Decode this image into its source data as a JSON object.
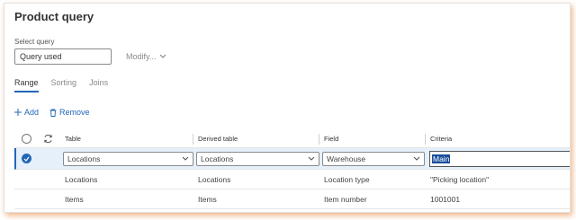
{
  "page": {
    "title": "Product query"
  },
  "query": {
    "label": "Select query",
    "value": "Query used"
  },
  "modify": {
    "label": "Modify..."
  },
  "tabs": [
    {
      "label": "Range"
    },
    {
      "label": "Sorting"
    },
    {
      "label": "Joins"
    }
  ],
  "toolbar": {
    "add_label": "Add",
    "remove_label": "Remove"
  },
  "grid": {
    "headers": {
      "table": "Table",
      "derived": "Derived table",
      "field": "Field",
      "criteria": "Criteria"
    },
    "rows": [
      {
        "table": "Locations",
        "derived": "Locations",
        "field": "Warehouse",
        "criteria": "Main"
      },
      {
        "table": "Locations",
        "derived": "Locations",
        "field": "Location type",
        "criteria": "\"Picking location\""
      },
      {
        "table": "Items",
        "derived": "Items",
        "field": "Item number",
        "criteria": "1001001"
      }
    ]
  },
  "colors": {
    "accent": "#2266b8",
    "selected_row": "#e5f0fb",
    "frame_shadow": "#e67828"
  }
}
